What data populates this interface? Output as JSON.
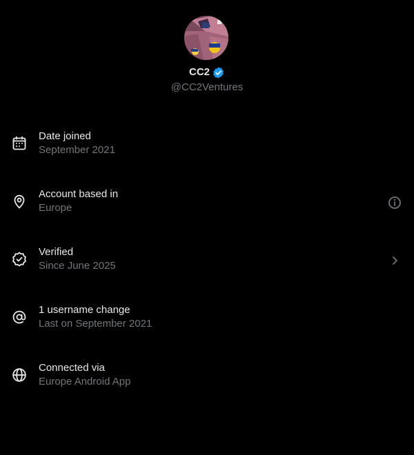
{
  "profile": {
    "display_name": "CC2",
    "handle": "@CC2Ventures",
    "verified_color": "#1d9bf0"
  },
  "info_rows": [
    {
      "icon": "calendar-icon",
      "title": "Date joined",
      "subtitle": "September 2021"
    },
    {
      "icon": "location-pin-icon",
      "title": "Account based in",
      "subtitle": "Europe",
      "trailing_icon": "info-icon"
    },
    {
      "icon": "verified-badge-icon",
      "title": "Verified",
      "subtitle": "Since June 2025",
      "trailing_icon": "chevron-right-icon"
    },
    {
      "icon": "at-sign-icon",
      "title": "1 username change",
      "subtitle": "Last on September 2021"
    },
    {
      "icon": "globe-icon",
      "title": "Connected via",
      "subtitle": "Europe Android App"
    }
  ],
  "colors": {
    "background": "#000000",
    "primary_text": "#e7e9ea",
    "secondary_text": "#71767b"
  }
}
